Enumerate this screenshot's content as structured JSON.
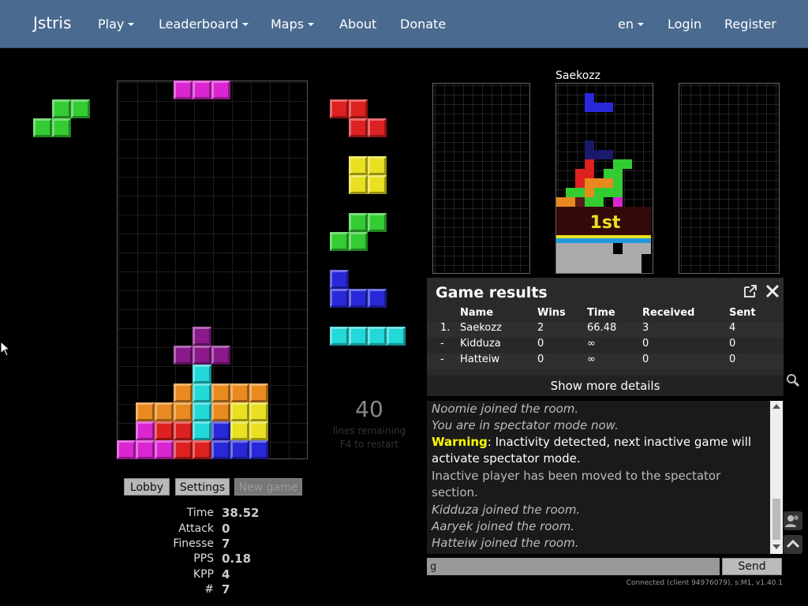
{
  "nav": {
    "brand": "Jstris",
    "items": [
      "Play",
      "Leaderboard",
      "Maps",
      "About",
      "Donate"
    ],
    "lang": "en",
    "login": "Login",
    "register": "Register"
  },
  "board_pieces": {
    "hold": "S",
    "next": [
      "Z",
      "O",
      "S",
      "J",
      "I"
    ]
  },
  "game": {
    "lines_count": "40",
    "lines_text": "lines remaining",
    "restart_hint": "F4 to restart"
  },
  "buttons": {
    "lobby": "Lobby",
    "settings": "Settings",
    "new_game": "New game"
  },
  "stats": [
    {
      "label": "Time",
      "value": "38.52"
    },
    {
      "label": "Attack",
      "value": "0"
    },
    {
      "label": "Finesse",
      "value": "7"
    },
    {
      "label": "PPS",
      "value": "0.18"
    },
    {
      "label": "KPP",
      "value": "4"
    },
    {
      "label": "#",
      "value": "7"
    }
  ],
  "opponent": {
    "name": "Saekozz",
    "place": "1st"
  },
  "results": {
    "title": "Game results",
    "headers": {
      "name": "Name",
      "wins": "Wins",
      "time": "Time",
      "received": "Received",
      "sent": "Sent"
    },
    "rows": [
      {
        "rank": "1.",
        "name": "Saekozz",
        "wins": "2",
        "time": "66.48",
        "received": "3",
        "sent": "4"
      },
      {
        "rank": "-",
        "name": "Kidduza",
        "wins": "0",
        "time": "∞",
        "received": "0",
        "sent": "0"
      },
      {
        "rank": "-",
        "name": "Hatteiw",
        "wins": "0",
        "time": "∞",
        "received": "0",
        "sent": "0"
      }
    ],
    "more": "Show more details"
  },
  "chat": {
    "lines": [
      "Noomie joined the room.",
      "You are in spectator mode now.",
      "Inactivity detected, next inactive game will",
      "activate spectator mode.",
      "Inactive player has been moved to the spectator",
      "section.",
      "Kidduza joined the room.",
      "Aaryek joined the room.",
      "Hatteiw joined the room."
    ],
    "warning_label": "Warning",
    "input_value": "g",
    "send": "Send"
  },
  "status": "Connected (client 94976079), s:M1, v1.40.1",
  "colors": {
    "nav_bg": "#4a6a8f",
    "magenta": "#d926d0",
    "green": "#33cc33",
    "red": "#dd2020",
    "yellow": "#e8e020",
    "blue": "#2828d8",
    "cyan": "#22d8d8",
    "orange": "#e88a20",
    "purple": "#8a1a8a",
    "warning": "#ffff00"
  }
}
